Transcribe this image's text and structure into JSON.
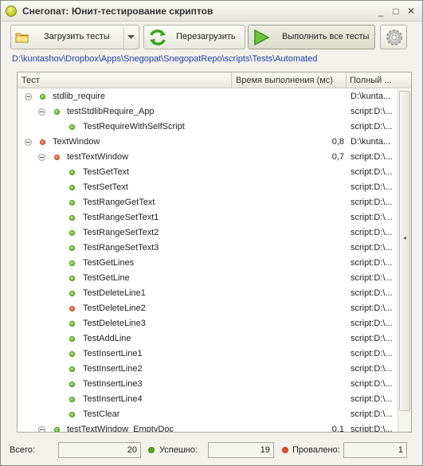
{
  "window": {
    "title": "Снегопат: Юнит-тестирование скриптов",
    "minimize_glyph": "_",
    "maximize_glyph": "□",
    "close_glyph": "✕"
  },
  "toolbar": {
    "load_label": "Загрузить тесты",
    "reload_label": "Перезагрузить",
    "run_all_label": "Выполнить все тесты",
    "icons": [
      "folder-icon",
      "chevron-down-icon",
      "reload-icon",
      "play-icon",
      "gear-icon"
    ]
  },
  "path": "D:\\kuntashov\\Dropbox\\Apps\\Snegopat\\SnegopatRepo\\scripts\\Tests\\Automated",
  "grid": {
    "headers": [
      "Тест",
      "Время выполнения (мс)",
      "Полный ..."
    ],
    "rows": [
      {
        "level": 0,
        "toggle": true,
        "status": "ok",
        "name": "stdlib_require",
        "time": "",
        "full": "D:\\kunta..."
      },
      {
        "level": 1,
        "toggle": true,
        "status": "ok",
        "name": "testStdlibRequire_App",
        "time": "",
        "full": "script:D:\\..."
      },
      {
        "level": 2,
        "toggle": false,
        "status": "ok",
        "name": "TestRequireWithSelfScript",
        "time": "",
        "full": "script:D:\\..."
      },
      {
        "level": 0,
        "toggle": true,
        "status": "fail",
        "name": "TextWindow",
        "time": "0,8",
        "full": "D:\\kunta..."
      },
      {
        "level": 1,
        "toggle": true,
        "status": "fail",
        "name": "testTextWindow",
        "time": "0,7",
        "full": "script:D:\\..."
      },
      {
        "level": 2,
        "toggle": false,
        "status": "ok",
        "name": "TestGetText",
        "time": "",
        "full": "script:D:\\..."
      },
      {
        "level": 2,
        "toggle": false,
        "status": "ok",
        "name": "TestSetText",
        "time": "",
        "full": "script:D:\\..."
      },
      {
        "level": 2,
        "toggle": false,
        "status": "ok",
        "name": "TestRangeGetText",
        "time": "",
        "full": "script:D:\\..."
      },
      {
        "level": 2,
        "toggle": false,
        "status": "ok",
        "name": "TestRangeSetText1",
        "time": "",
        "full": "script:D:\\..."
      },
      {
        "level": 2,
        "toggle": false,
        "status": "ok",
        "name": "TestRangeSetText2",
        "time": "",
        "full": "script:D:\\..."
      },
      {
        "level": 2,
        "toggle": false,
        "status": "ok",
        "name": "TestRangeSetText3",
        "time": "",
        "full": "script:D:\\..."
      },
      {
        "level": 2,
        "toggle": false,
        "status": "ok",
        "name": "TestGetLines",
        "time": "",
        "full": "script:D:\\..."
      },
      {
        "level": 2,
        "toggle": false,
        "status": "ok",
        "name": "TestGetLine",
        "time": "",
        "full": "script:D:\\..."
      },
      {
        "level": 2,
        "toggle": false,
        "status": "ok",
        "name": "TestDeleteLine1",
        "time": "",
        "full": "script:D:\\..."
      },
      {
        "level": 2,
        "toggle": false,
        "status": "fail",
        "name": "TestDeleteLine2",
        "time": "",
        "full": "script:D:\\..."
      },
      {
        "level": 2,
        "toggle": false,
        "status": "ok",
        "name": "TestDeleteLine3",
        "time": "",
        "full": "script:D:\\..."
      },
      {
        "level": 2,
        "toggle": false,
        "status": "ok",
        "name": "TestAddLine",
        "time": "",
        "full": "script:D:\\..."
      },
      {
        "level": 2,
        "toggle": false,
        "status": "ok",
        "name": "TestInsertLine1",
        "time": "",
        "full": "script:D:\\..."
      },
      {
        "level": 2,
        "toggle": false,
        "status": "ok",
        "name": "TestInsertLine2",
        "time": "",
        "full": "script:D:\\..."
      },
      {
        "level": 2,
        "toggle": false,
        "status": "ok",
        "name": "TestInsertLine3",
        "time": "",
        "full": "script:D:\\..."
      },
      {
        "level": 2,
        "toggle": false,
        "status": "ok",
        "name": "TestInsertLine4",
        "time": "",
        "full": "script:D:\\..."
      },
      {
        "level": 2,
        "toggle": false,
        "status": "ok",
        "name": "TestClear",
        "time": "",
        "full": "script:D:\\..."
      },
      {
        "level": 1,
        "toggle": true,
        "status": "ok",
        "name": "testTextWindow_EmptyDoc",
        "time": "0,1",
        "full": "script:D:\\..."
      }
    ]
  },
  "footer": {
    "total_label": "Всего:",
    "total_value": "20",
    "passed_label": "Успешно:",
    "passed_value": "19",
    "failed_label": "Провалено:",
    "failed_value": "1"
  },
  "colors": {
    "ok": "#4fae16",
    "fail": "#e0502f",
    "path_link": "#1f3ea3"
  }
}
